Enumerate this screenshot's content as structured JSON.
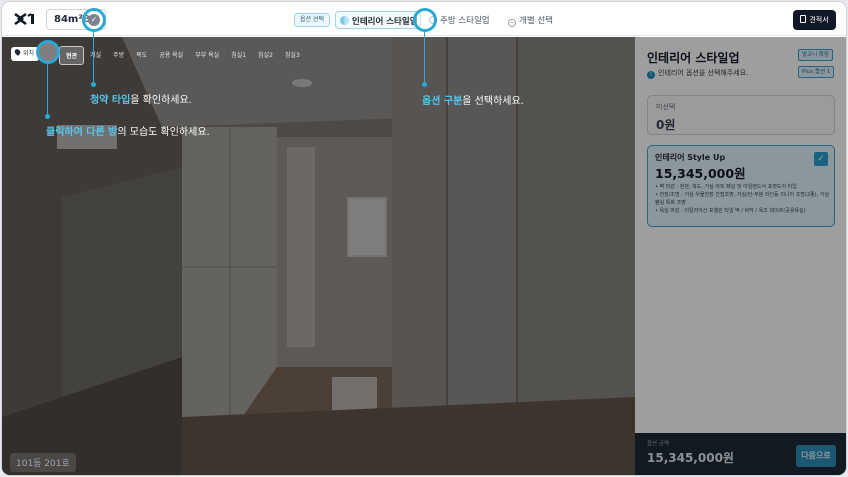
{
  "header": {
    "unit_type": "84m²B",
    "option_badge": "옵션 선택",
    "tabs": [
      {
        "label": "인테리어 스타일업",
        "active": true
      },
      {
        "label": "주방 스타일업",
        "active": false
      },
      {
        "label": "개별 선택",
        "active": false
      }
    ],
    "quote_label": "견적서"
  },
  "viewer": {
    "location_label": "위치",
    "rooms": [
      "현관",
      "거실",
      "주방",
      "복도",
      "공용 욕실",
      "부부 욕실",
      "침실1",
      "침실2",
      "침실3"
    ],
    "active_room": "현관",
    "unit_label": "101동 201호"
  },
  "guides": {
    "type": {
      "highlight": "청약 타입",
      "rest": "을 확인하세요."
    },
    "room": {
      "highlight": "클릭하여 다른 방",
      "rest": "의 모습도 확인하세요."
    },
    "option": {
      "highlight": "옵션 구분",
      "rest": "을 선택하세요."
    }
  },
  "panel": {
    "title": "인테리어 스타일업",
    "subtitle": "인테리어 옵션을 선택해주세요.",
    "badge_top": "발코니 확장",
    "badge_bottom": "Plus 옵션 1",
    "none_option": {
      "label": "미선택",
      "price": "0원"
    },
    "selected_option": {
      "name": "인테리어 Style Up",
      "price": "15,345,000원",
      "desc": [
        "• 벽 마감 : 현관, 복도, 거실 아트 패널 및 아일랜드식 포켓도어 타입",
        "• 천장/조명 : 거실 우물천장 간접조명, 거실/안-부분 라인등 리니어 조명(2종), 거실 램실 특화 조명",
        "• 욕실 마감 : 이탈리아산 포셀린 타일 벽 / 바닥 / 욕조 데이르(공용욕실)"
      ]
    },
    "total": {
      "label": "옵션 금액",
      "amount": "15,345,000원"
    },
    "next_label": "다음으로"
  },
  "colors": {
    "accent": "#2aa8d6",
    "dark": "#111827",
    "selected_bg": "#e3f4fb"
  }
}
